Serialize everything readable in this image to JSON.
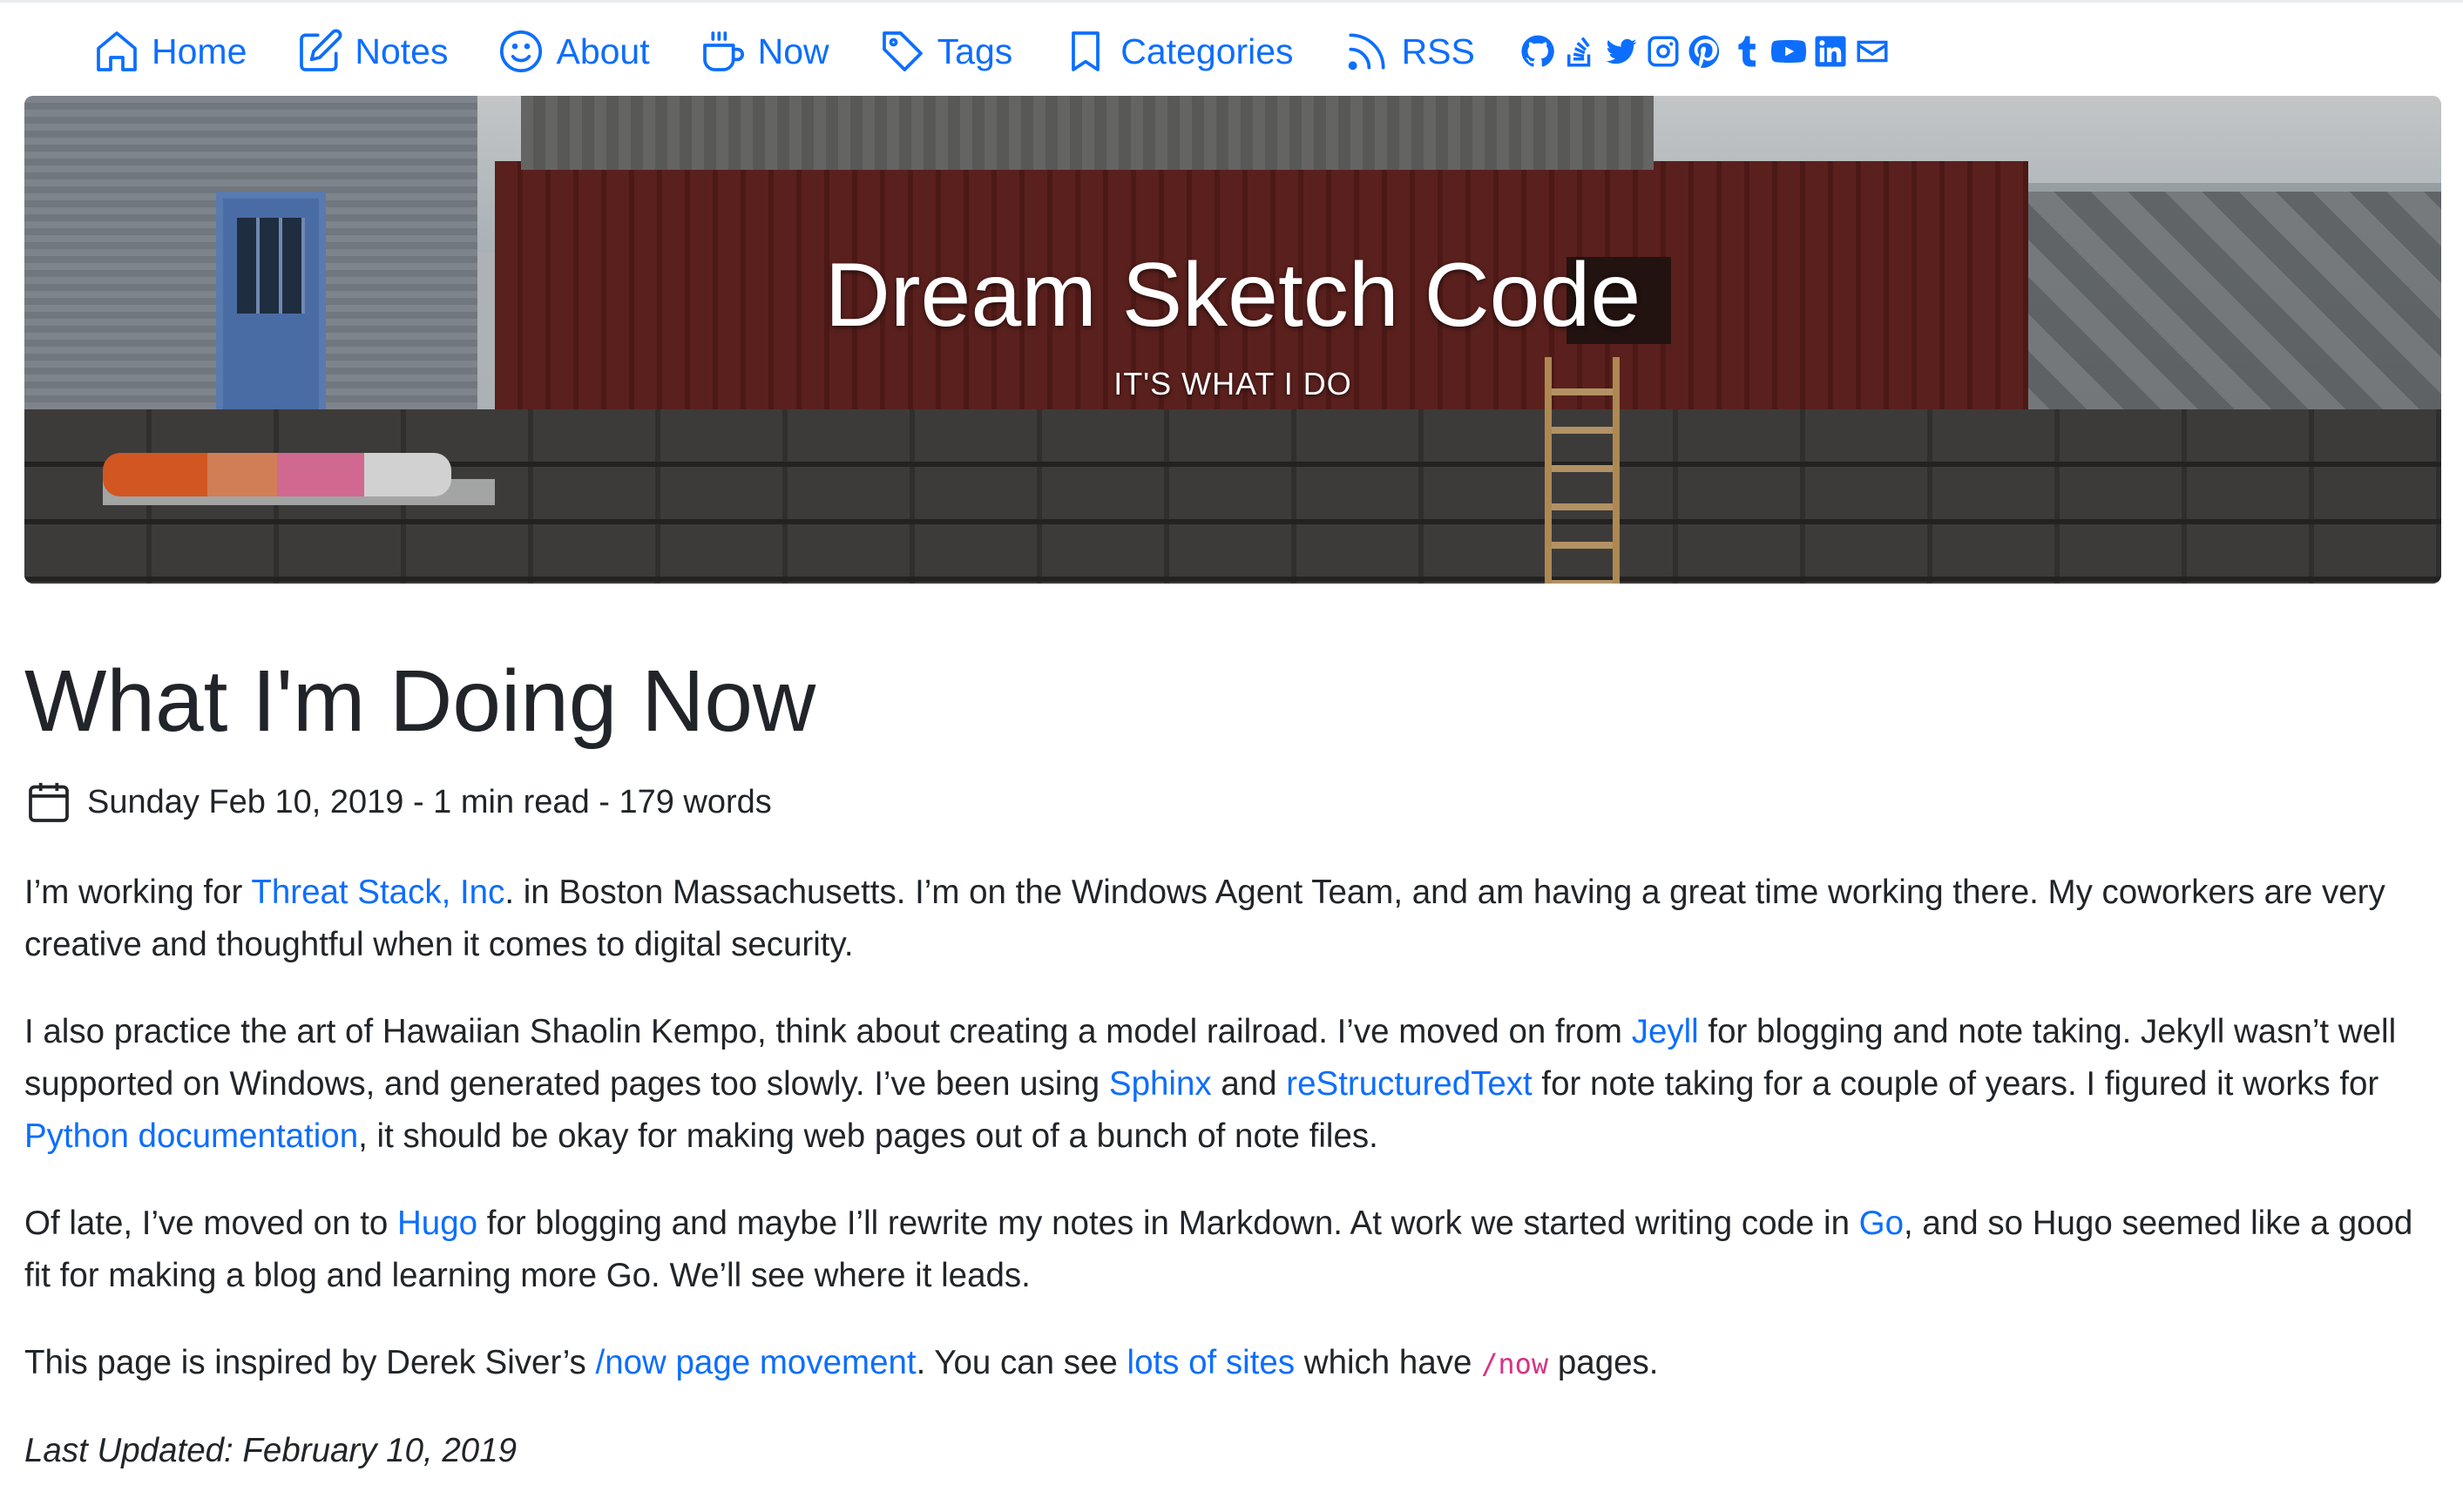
{
  "nav": {
    "items": [
      {
        "label": "Home",
        "icon": "home-icon"
      },
      {
        "label": "Notes",
        "icon": "pencil-square-icon"
      },
      {
        "label": "About",
        "icon": "smile-icon"
      },
      {
        "label": "Now",
        "icon": "cup-icon"
      },
      {
        "label": "Tags",
        "icon": "tag-icon"
      },
      {
        "label": "Categories",
        "icon": "bookmark-icon"
      },
      {
        "label": "RSS",
        "icon": "rss-icon"
      }
    ],
    "social": [
      "github-icon",
      "stackoverflow-icon",
      "twitter-icon",
      "instagram-icon",
      "pinterest-icon",
      "tumblr-icon",
      "youtube-icon",
      "linkedin-icon",
      "envelope-icon"
    ]
  },
  "banner": {
    "title": "Dream Sketch Code",
    "subtitle": "IT'S WHAT I DO"
  },
  "article": {
    "title": "What I'm Doing Now",
    "meta": "Sunday Feb 10, 2019 - 1 min read - 179 words",
    "p1": {
      "t1": "I’m working for ",
      "l1": "Threat Stack, Inc",
      "t2": ". in Boston Massachusetts. I’m on the Windows Agent Team, and am having a great time working there. My coworkers are very creative and thoughtful when it comes to digital security."
    },
    "p2": {
      "t1": "I also practice the art of Hawaiian Shaolin Kempo, think about creating a model railroad. I’ve moved on from ",
      "l1": "Jeyll",
      "t2": " for blogging and note taking. Jekyll wasn’t well supported on Windows, and generated pages too slowly. I’ve been using ",
      "l2": "Sphinx",
      "t3": " and ",
      "l3": "reStructuredText",
      "t4": " for note taking for a couple of years. I figured it works for ",
      "l4": "Python documentation",
      "t5": ", it should be okay for making web pages out of a bunch of note files."
    },
    "p3": {
      "t1": "Of late, I’ve moved on to ",
      "l1": "Hugo",
      "t2": " for blogging and maybe I’ll rewrite my notes in Markdown. At work we started writing code in ",
      "l2": "Go",
      "t3": ", and so Hugo seemed like a good fit for making a blog and learning more Go. We’ll see where it leads."
    },
    "p4": {
      "t1": "This page is inspired by Derek Siver’s ",
      "l1": "/now page movement",
      "t2": ". You can see ",
      "l2": "lots of sites",
      "t3": " which have ",
      "code": "/now",
      "t4": " pages."
    },
    "updated": "Last Updated: February 10, 2019"
  },
  "colors": {
    "link": "#0d6efd",
    "text": "#212529",
    "code": "#d63384"
  }
}
